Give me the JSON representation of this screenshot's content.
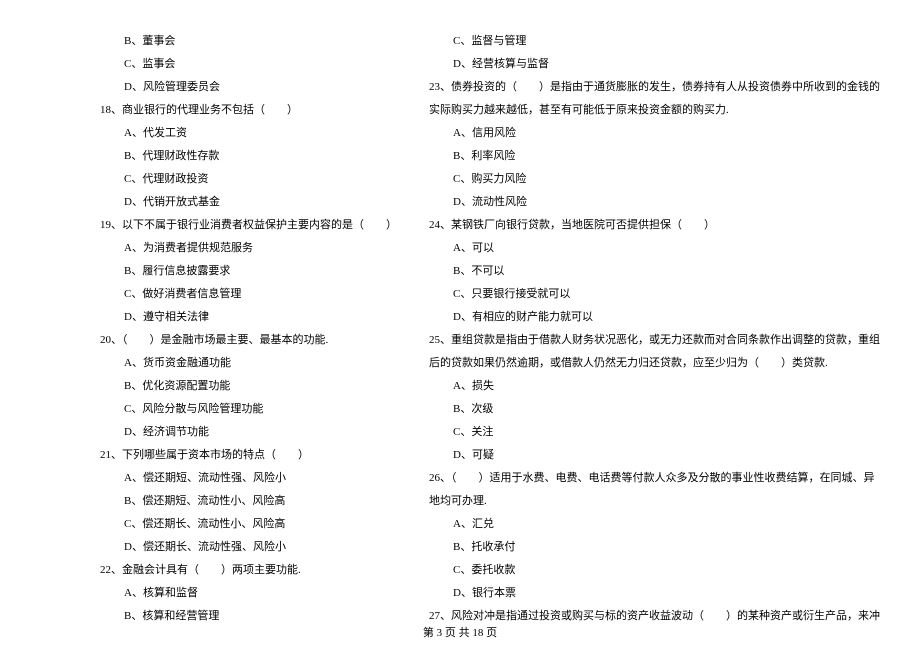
{
  "left_column": {
    "q17_opts": {
      "b": "B、董事会",
      "c": "C、监事会",
      "d": "D、风险管理委员会"
    },
    "q18": {
      "stem": "18、商业银行的代理业务不包括（　　）",
      "opts": {
        "a": "A、代发工资",
        "b": "B、代理财政性存款",
        "c": "C、代理财政投资",
        "d": "D、代销开放式基金"
      }
    },
    "q19": {
      "stem": "19、以下不属于银行业消费者权益保护主要内容的是（　　）",
      "opts": {
        "a": "A、为消费者提供规范服务",
        "b": "B、履行信息披露要求",
        "c": "C、做好消费者信息管理",
        "d": "D、遵守相关法律"
      }
    },
    "q20": {
      "stem": "20、（　　）是金融市场最主要、最基本的功能.",
      "opts": {
        "a": "A、货币资金融通功能",
        "b": "B、优化资源配置功能",
        "c": "C、风险分散与风险管理功能",
        "d": "D、经济调节功能"
      }
    },
    "q21": {
      "stem": "21、下列哪些属于资本市场的特点（　　）",
      "opts": {
        "a": "A、偿还期短、流动性强、风险小",
        "b": "B、偿还期短、流动性小、风险高",
        "c": "C、偿还期长、流动性小、风险高",
        "d": "D、偿还期长、流动性强、风险小"
      }
    },
    "q22": {
      "stem": "22、金融会计具有（　　）两项主要功能.",
      "opts": {
        "a": "A、核算和监督",
        "b": "B、核算和经营管理"
      }
    }
  },
  "right_column": {
    "q22_opts": {
      "c": "C、监督与管理",
      "d": "D、经营核算与监督"
    },
    "q23": {
      "stem_1": "23、债券投资的（　　）是指由于通货膨胀的发生，债券持有人从投资债券中所收到的金钱的",
      "stem_2": "实际购买力越来越低，甚至有可能低于原来投资金额的购买力.",
      "opts": {
        "a": "A、信用风险",
        "b": "B、利率风险",
        "c": "C、购买力风险",
        "d": "D、流动性风险"
      }
    },
    "q24": {
      "stem": "24、某钢铁厂向银行贷款，当地医院可否提供担保（　　）",
      "opts": {
        "a": "A、可以",
        "b": "B、不可以",
        "c": "C、只要银行接受就可以",
        "d": "D、有相应的财产能力就可以"
      }
    },
    "q25": {
      "stem_1": "25、重组贷款是指由于借款人财务状况恶化，或无力还款而对合同条款作出调整的贷款，重组",
      "stem_2": "后的贷款如果仍然逾期，或借款人仍然无力归还贷款，应至少归为（　　）类贷款.",
      "opts": {
        "a": "A、损失",
        "b": "B、次级",
        "c": "C、关注",
        "d": "D、可疑"
      }
    },
    "q26": {
      "stem_1": "26、（　　）适用于水费、电费、电话费等付款人众多及分散的事业性收费结算，在同城、异",
      "stem_2": "地均可办理.",
      "opts": {
        "a": "A、汇兑",
        "b": "B、托收承付",
        "c": "C、委托收款",
        "d": "D、银行本票"
      }
    },
    "q27": {
      "stem": "27、风险对冲是指通过投资或购买与标的资产收益波动（　　）的某种资产或衍生产品，来冲"
    }
  },
  "footer": "第 3 页 共 18 页"
}
